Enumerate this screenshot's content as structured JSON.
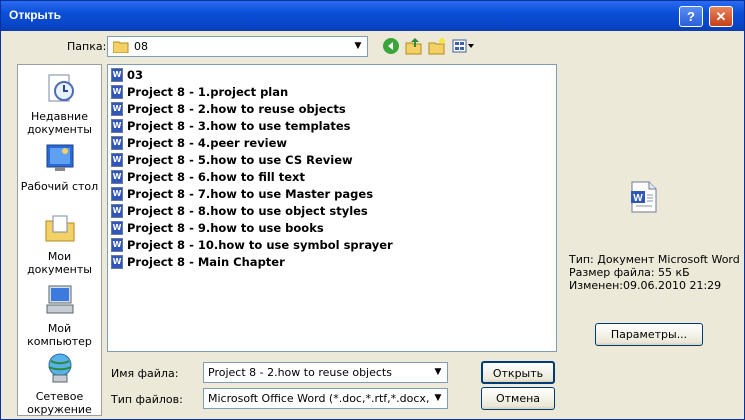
{
  "window": {
    "title": "Открыть",
    "help_label": "?",
    "close_label": "✕"
  },
  "lookin": {
    "label": "Папка:",
    "value": "08"
  },
  "toolbar": {
    "back_icon": "back-arrow-icon",
    "up_icon": "up-folder-icon",
    "new_folder_icon": "new-folder-icon",
    "views_icon": "views-menu-icon"
  },
  "places": [
    {
      "label": "Недавние документы",
      "icon": "recent-documents-icon"
    },
    {
      "label": "Рабочий стол",
      "icon": "desktop-icon"
    },
    {
      "label": "Мои документы",
      "icon": "my-documents-icon"
    },
    {
      "label": "Мой компьютер",
      "icon": "my-computer-icon"
    },
    {
      "label": "Сетевое окружение",
      "icon": "network-places-icon"
    }
  ],
  "files": [
    "03",
    "Project 8 -  1.project plan",
    "Project 8 - 2.how to reuse objects",
    "Project 8 - 3.how to use templates",
    "Project 8 - 4.peer review",
    "Project 8 - 5.how to use CS Review",
    "Project 8 - 6.how to fill text",
    "Project 8 - 7.how to use Master pages",
    "Project 8 - 8.how to use object styles",
    "Project 8 - 9.how to use books",
    "Project 8 - 10.how to use symbol sprayer",
    "Project 8 - Main Chapter"
  ],
  "selected_index": 2,
  "preview": {
    "icon": "word-document-icon",
    "type_line": "Тип: Документ Microsoft Word",
    "size_line": "Размер файла: 55 кБ",
    "modified_line": "Изменен:09.06.2010 21:29"
  },
  "params_button": "Параметры...",
  "filename": {
    "label": "Имя файла:",
    "value": "Project 8 - 2.how to reuse objects"
  },
  "filetype": {
    "label": "Тип файлов:",
    "value": "Microsoft Office Word (*.doc,*.rtf,*.docx,*.docm"
  },
  "open_button": "Открыть",
  "cancel_button": "Отмена"
}
